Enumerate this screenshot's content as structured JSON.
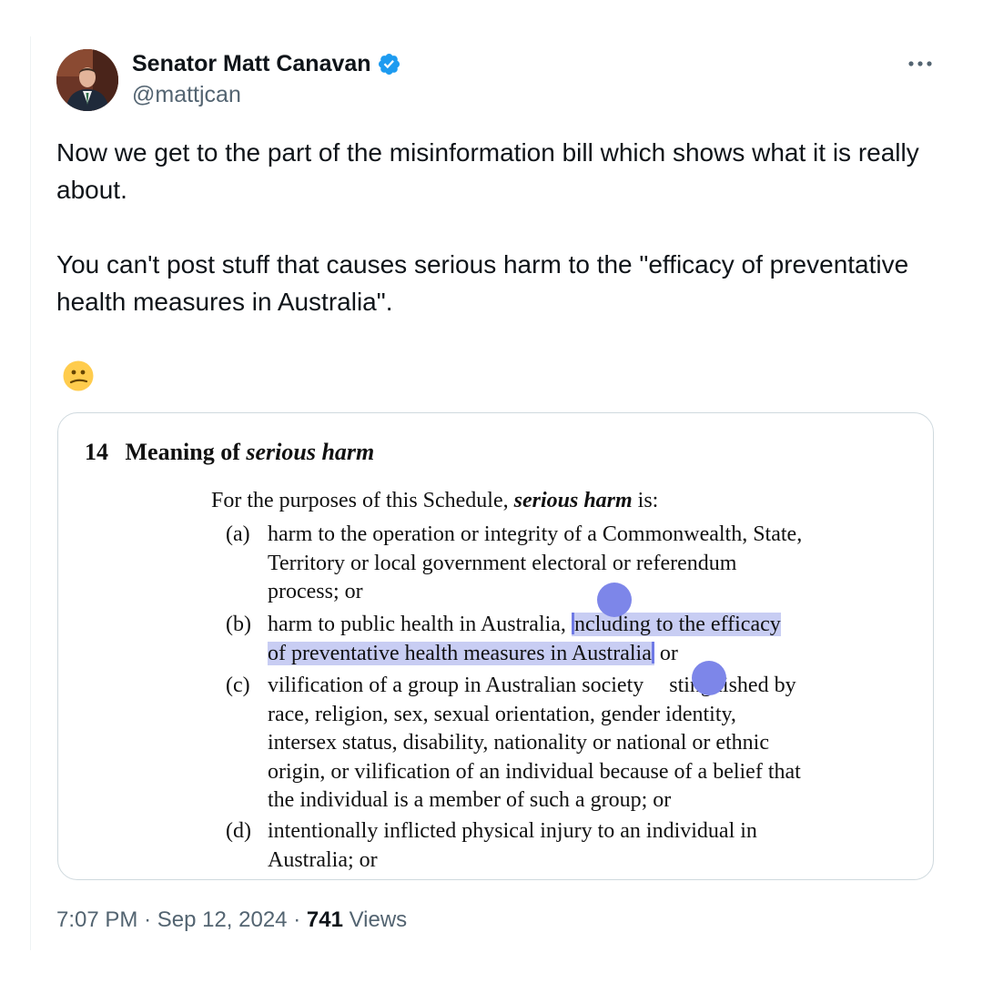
{
  "author": {
    "name": "Senator Matt Canavan",
    "handle": "@mattjcan",
    "verified": true,
    "avatar_icon": "profile-photo"
  },
  "tweet": {
    "paragraphs": [
      "Now we get to the part of the misinformation bill which shows what it is really about.",
      "You can't post stuff that causes serious harm to the \"efficacy of preventative health measures in Australia\"."
    ],
    "emoji": "😕"
  },
  "document": {
    "heading_number": "14",
    "heading_text": "Meaning of",
    "heading_term": "serious harm",
    "intro_before": "For the purposes of this Schedule,",
    "intro_term": "serious harm",
    "intro_after": "is:",
    "clauses": [
      {
        "label": "(a)",
        "lines": [
          "harm to the operation or integrity of a Commonwealth, State,",
          "Territory or local government electoral or referendum",
          "process; or"
        ]
      },
      {
        "label": "(b)",
        "line1_plain": "harm to public health in Australia,",
        "line1_highlight": "ncluding to the efficacy",
        "line2_highlight": "of preventative health measures in Australia",
        "line2_after": "or"
      },
      {
        "label": "(c)",
        "line1_before": "vilification of a group in Australian society",
        "line1_after": "stinguished by",
        "lines": [
          "race, religion, sex, sexual orientation, gender identity,",
          "intersex status, disability, nationality or national or ethnic",
          "origin, or vilification of an individual because of a belief that",
          "the individual is a member of such a group; or"
        ]
      },
      {
        "label": "(d)",
        "lines": [
          "intentionally inflicted physical injury to an individual in",
          "Australia; or"
        ]
      }
    ]
  },
  "meta": {
    "time": "7:07 PM",
    "date": "Sep 12, 2024",
    "separator": "·",
    "views_count": "741",
    "views_label": "Views"
  },
  "colors": {
    "text_primary": "#0f1419",
    "text_secondary": "#536471",
    "verified_blue": "#1d9bf0",
    "border": "#cfd9de",
    "selection_highlight": "#c8cdf3",
    "selection_handle": "#7d86e9"
  }
}
